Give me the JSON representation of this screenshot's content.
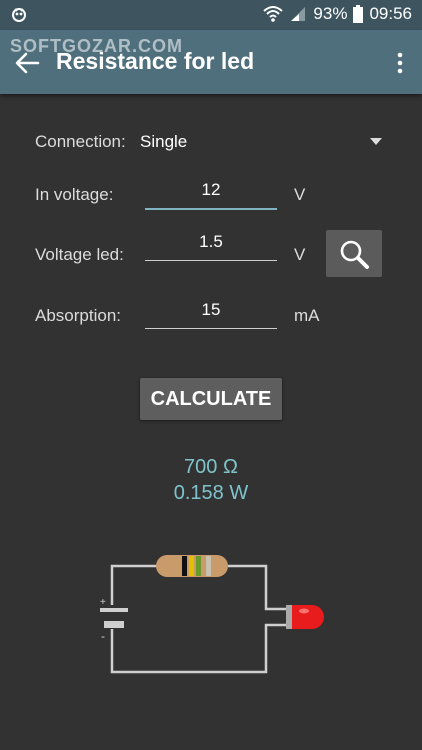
{
  "status_bar": {
    "battery": "93%",
    "time": "09:56"
  },
  "app_bar": {
    "title": "Resistance for led",
    "watermark": "SOFTGOZAR.COM"
  },
  "form": {
    "connection": {
      "label": "Connection:",
      "value": "Single"
    },
    "in_voltage": {
      "label": "In voltage:",
      "value": "12",
      "unit": "V"
    },
    "voltage_led": {
      "label": "Voltage led:",
      "value": "1.5",
      "unit": "V"
    },
    "absorption": {
      "label": "Absorption:",
      "value": "15",
      "unit": "mA"
    }
  },
  "calculate_label": "CALCULATE",
  "results": {
    "resistance": "700 Ω",
    "power": "0.158 W"
  },
  "circuit": {
    "battery_plus": "+",
    "battery_minus": "-"
  },
  "colors": {
    "background": "#323232",
    "app_bar": "#4f6f7d",
    "status_bar": "#3e5560",
    "accent": "#7fc4cc",
    "led": "#e81c1c"
  }
}
